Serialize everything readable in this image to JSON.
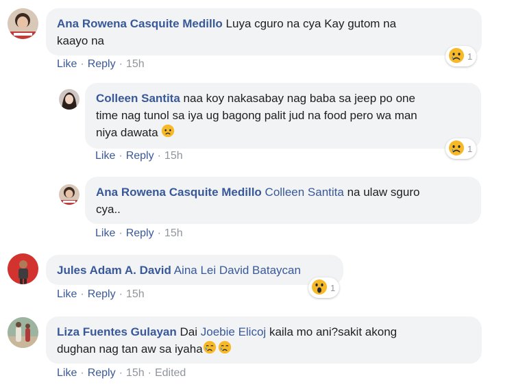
{
  "actions": {
    "like": "Like",
    "reply": "Reply",
    "separator": "·"
  },
  "comments": [
    {
      "author": "Ana Rowena Casquite Medillo",
      "text_line1": "Luya cguro na cya Kay gutom na",
      "text_line2": "kaayo na",
      "time": "15h",
      "reaction": {
        "type": "sad",
        "count": "1"
      }
    },
    {
      "author": "Colleen Santita",
      "text_line1": "naa koy nakasabay nag baba sa jeep po one",
      "text_line2": "time nag tunol sa iya ug bagong palit jud na food pero wa man",
      "text_line3": "niya dawata",
      "time": "15h",
      "reaction": {
        "type": "sad",
        "count": "1"
      }
    },
    {
      "author": "Ana Rowena Casquite Medillo",
      "mention": "Colleen Santita",
      "text_line1": "na ulaw sguro",
      "text_line2": "cya..",
      "time": "15h"
    },
    {
      "author": "Jules Adam A. David",
      "mention": "Aina Lei David Bataycan",
      "time": "15h",
      "reaction": {
        "type": "wow",
        "count": "1"
      }
    },
    {
      "author": "Liza Fuentes Gulayan",
      "text_pre": "Dai",
      "mention": "Joebie Elicoj",
      "text_line1": "kaila mo ani?sakit akong",
      "text_line2": "dughan nag tan aw sa iyaha",
      "time": "15h",
      "edited": "Edited"
    }
  ],
  "colors": {
    "link": "#385898",
    "bubble": "#f2f3f5",
    "meta": "#90949c"
  }
}
